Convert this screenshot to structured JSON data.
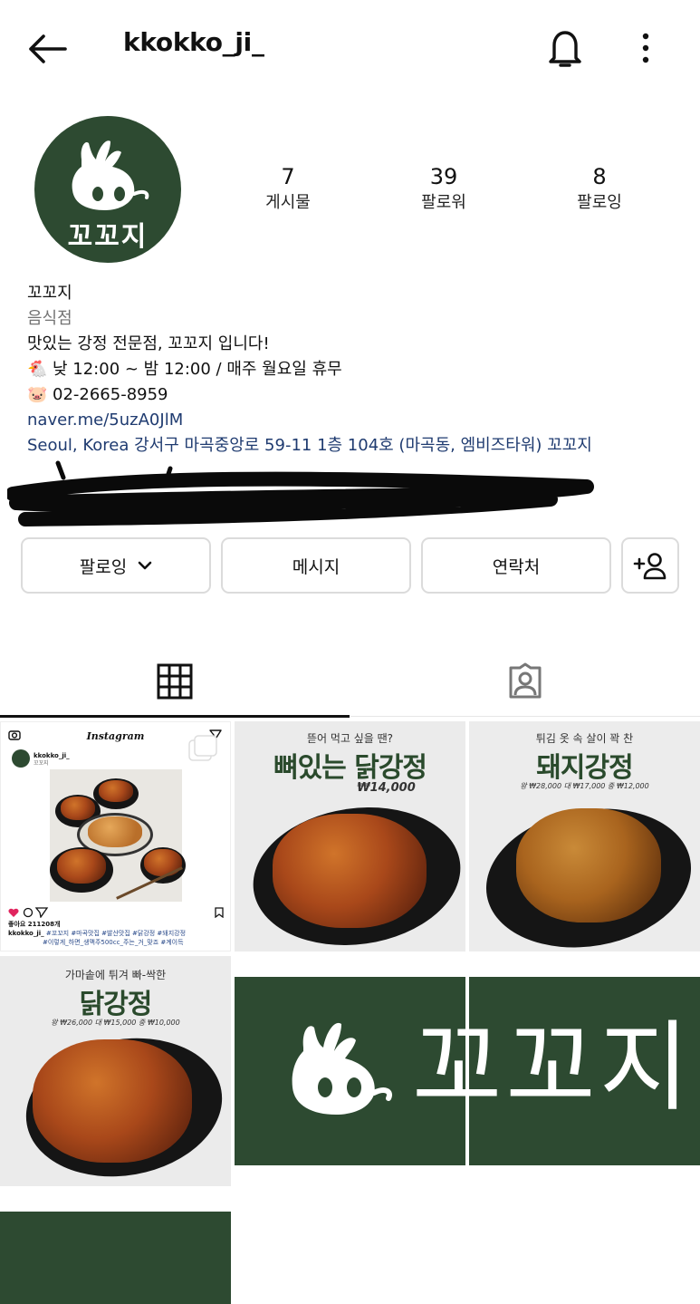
{
  "header": {
    "username": "kkokko_ji_",
    "back_icon": "arrow-left-icon",
    "notification_icon": "bell-icon",
    "more_icon": "more-vertical-icon"
  },
  "profile": {
    "avatar_text": "꼬꼬지",
    "stats": [
      {
        "value": "7",
        "label": "게시물"
      },
      {
        "value": "39",
        "label": "팔로워"
      },
      {
        "value": "8",
        "label": "팔로잉"
      }
    ]
  },
  "bio": {
    "name": "꼬꼬지",
    "category": "음식점",
    "description": "맛있는 강정 전문점, 꼬꼬지 입니다!",
    "hours_emoji": "🐔",
    "hours": "낮 12:00 ~ 밤 12:00 / 매주 월요일 휴무",
    "phone_emoji": "🐷",
    "phone": "02-2665-8959",
    "link": "naver.me/5uzA0JlM",
    "address": "Seoul, Korea 강서구 마곡중앙로 59-11 1층 104호 (마곡동, 엠비즈타워) 꼬꼬지"
  },
  "actions": {
    "following_label": "팔로잉",
    "message_label": "메시지",
    "contact_label": "연락처",
    "add_person_icon": "add-person-icon"
  },
  "tabs": {
    "grid_icon": "grid-icon",
    "tagged_icon": "tagged-person-icon"
  },
  "posts": {
    "post1": {
      "title": "Instagram",
      "account": "kkokko_ji_",
      "account_sub": "꼬꼬지",
      "likes": "좋아요 211208개",
      "caption_user": "kkokko_ji_",
      "caption_tags": "#꼬꼬지 #마곡맛집 #발산맛집 #닭강정 #돼지강정",
      "caption_tags2": "#이렇게_하면_생맥주500cc_주는_거_맞죠 #계이득"
    },
    "post2": {
      "caption": "뜯어 먹고 싶을 땐?",
      "title": "뼈있는 닭강정",
      "price": "₩14,000"
    },
    "post3": {
      "caption": "튀김 옷 속 살이 꽉 찬",
      "title": "돼지강정",
      "price": "왕 ₩28,000     대 ₩17,000     중 ₩12,000"
    },
    "post4": {
      "caption": "가마솥에 튀겨 빠-싹한",
      "title": "닭강정",
      "price": "왕 ₩26,000     대 ₩15,000     중 ₩10,000"
    },
    "post5": {
      "logo_text": "꼬꼬지"
    }
  },
  "colors": {
    "brand_green": "#2d4a31",
    "link_blue": "#1f3b70"
  }
}
